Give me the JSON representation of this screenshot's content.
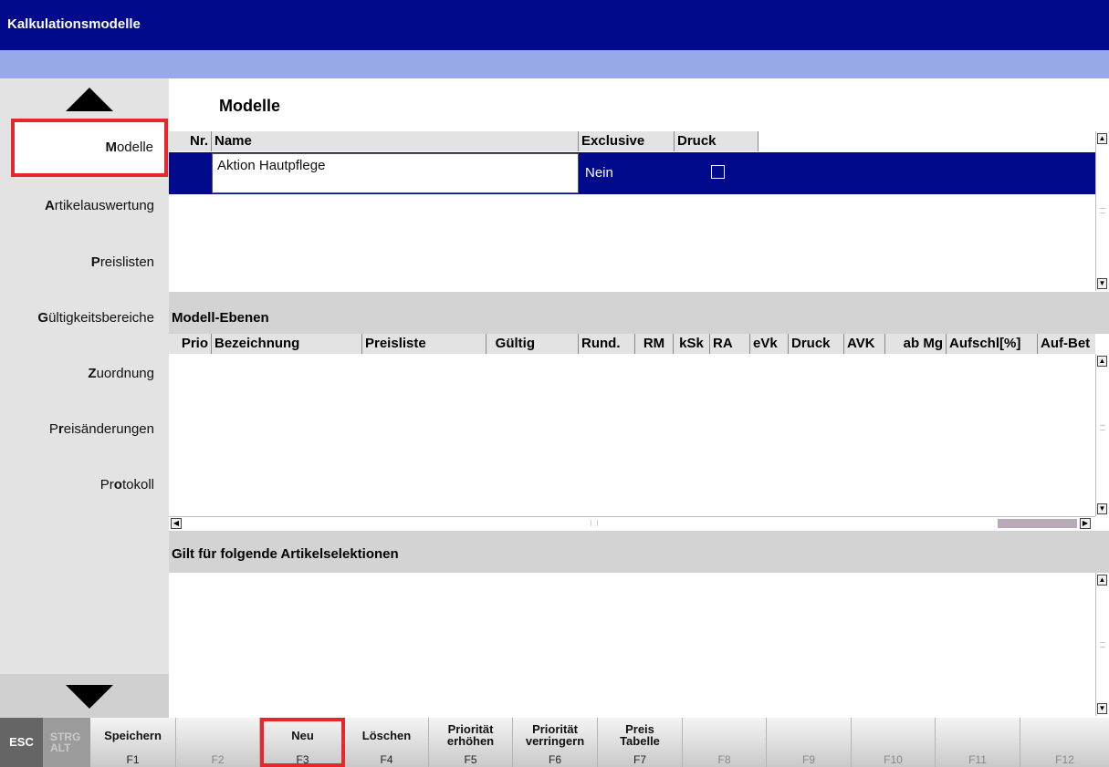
{
  "window": {
    "title": "Kalkulationsmodelle"
  },
  "sidebar": {
    "items": [
      {
        "hotkey": "M",
        "rest": "odelle",
        "active": true
      },
      {
        "hotkey": "A",
        "rest": "rtikelauswertung"
      },
      {
        "hotkey": "P",
        "rest": "reislisten"
      },
      {
        "hotkey": "G",
        "rest": "ültigkeitsbereiche"
      },
      {
        "hotkey": "Z",
        "rest": "uordnung"
      },
      {
        "pre": "P",
        "hotkey": "r",
        "rest": "eisänderungen"
      },
      {
        "pre": "Pr",
        "hotkey": "o",
        "rest": "tokoll"
      }
    ]
  },
  "modelle": {
    "title": "Modelle",
    "columns": [
      "Nr.",
      "Name",
      "Exclusive",
      "Druck"
    ],
    "rows": [
      {
        "nr": "",
        "name": "Aktion Hautpflege",
        "exclusive": "Nein",
        "druck": false
      }
    ]
  },
  "ebenen": {
    "title": "Modell-Ebenen",
    "columns": [
      "Prio",
      "Bezeichnung",
      "Preisliste",
      "Gültig",
      "Rund.",
      "RM",
      "kSk",
      "RA",
      "eVk",
      "Druck",
      "AVK",
      "ab Mg",
      "Aufschl[%]",
      "Auf-Bet"
    ]
  },
  "selektionen": {
    "title": "Gilt für folgende Artikelselektionen"
  },
  "fkeys": {
    "esc": "ESC",
    "strg": "STRG",
    "alt": "ALT",
    "keys": [
      {
        "label": "Speichern",
        "code": "F1"
      },
      {
        "label": "",
        "code": "F2"
      },
      {
        "label": "Neu",
        "code": "F3"
      },
      {
        "label": "Löschen",
        "code": "F4"
      },
      {
        "label": "Priorität erhöhen",
        "code": "F5"
      },
      {
        "label": "Priorität verringern",
        "code": "F6"
      },
      {
        "label": "Preis Tabelle",
        "code": "F7"
      },
      {
        "label": "",
        "code": "F8"
      },
      {
        "label": "",
        "code": "F9"
      },
      {
        "label": "",
        "code": "F10"
      },
      {
        "label": "",
        "code": "F11"
      },
      {
        "label": "",
        "code": "F12"
      }
    ]
  },
  "colors": {
    "titlebar": "#020a8c",
    "subbar": "#97a9e9",
    "selection": "#020a8c",
    "highlight": "#e8262b"
  }
}
